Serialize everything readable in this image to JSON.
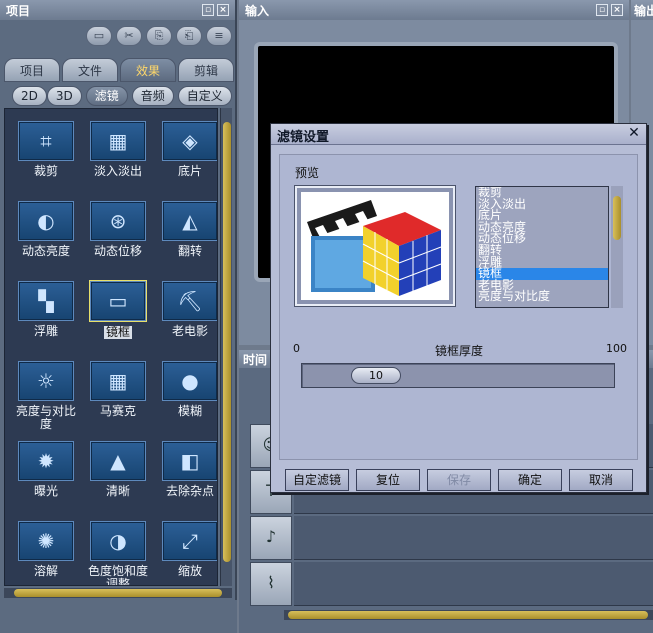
{
  "project_panel": {
    "title": "项目",
    "tabs": [
      {
        "label": "项目",
        "active": false
      },
      {
        "label": "文件",
        "active": false
      },
      {
        "label": "效果",
        "active": true
      },
      {
        "label": "剪辑",
        "active": false
      }
    ],
    "subtabs": [
      {
        "label": "2D",
        "active": false
      },
      {
        "label": "3D",
        "active": false
      },
      {
        "label": "滤镜",
        "active": true
      },
      {
        "label": "音频",
        "active": false
      },
      {
        "label": "自定义",
        "active": false
      }
    ],
    "effects": [
      {
        "label": "裁剪",
        "icon": "crop-icon",
        "glyph": "⌗"
      },
      {
        "label": "淡入淡出",
        "icon": "fade-icon",
        "glyph": "▦"
      },
      {
        "label": "底片",
        "icon": "negative-icon",
        "glyph": "◈"
      },
      {
        "label": "动态亮度",
        "icon": "brightness-icon",
        "glyph": "◐"
      },
      {
        "label": "动态位移",
        "icon": "motion-icon",
        "glyph": "⊛"
      },
      {
        "label": "翻转",
        "icon": "flip-icon",
        "glyph": "◭"
      },
      {
        "label": "浮雕",
        "icon": "emboss-icon",
        "glyph": "▚"
      },
      {
        "label": "镜框",
        "icon": "frame-icon",
        "glyph": "▭"
      },
      {
        "label": "老电影",
        "icon": "old-film-icon",
        "glyph": "⛏"
      },
      {
        "label": "亮度与对比度",
        "icon": "lightbulb-icon",
        "glyph": "☼"
      },
      {
        "label": "马赛克",
        "icon": "mosaic-icon",
        "glyph": "▦"
      },
      {
        "label": "模糊",
        "icon": "blur-icon",
        "glyph": "●"
      },
      {
        "label": "曝光",
        "icon": "exposure-icon",
        "glyph": "✹"
      },
      {
        "label": "清晰",
        "icon": "sharpen-icon",
        "glyph": "▲"
      },
      {
        "label": "去除杂点",
        "icon": "eraser-icon",
        "glyph": "◧"
      },
      {
        "label": "溶解",
        "icon": "dissolve-icon",
        "glyph": "✺"
      },
      {
        "label": "色度饱和度调整",
        "icon": "saturation-icon",
        "glyph": "◑"
      },
      {
        "label": "缩放",
        "icon": "zoom-icon",
        "glyph": "⤢"
      }
    ],
    "selected_effect": "镜框"
  },
  "input_panel": {
    "title": "输入"
  },
  "output_panel": {
    "title": "输出"
  },
  "timeline_panel": {
    "title": "时间"
  },
  "dialog": {
    "title": "滤镜设置",
    "preview_label": "预览",
    "filters": [
      "裁剪",
      "淡入淡出",
      "底片",
      "动态亮度",
      "动态位移",
      "翻转",
      "浮雕",
      "镜框",
      "老电影",
      "亮度与对比度"
    ],
    "selected_filter": "镜框",
    "slider": {
      "min_label": "0",
      "max_label": "100",
      "title": "镜框厚度",
      "value": 10,
      "min": 0,
      "max": 100
    },
    "buttons": [
      {
        "label": "自定滤镜",
        "enabled": true
      },
      {
        "label": "复位",
        "enabled": true
      },
      {
        "label": "保存",
        "enabled": false
      },
      {
        "label": "确定",
        "enabled": true
      },
      {
        "label": "取消",
        "enabled": true
      }
    ]
  }
}
